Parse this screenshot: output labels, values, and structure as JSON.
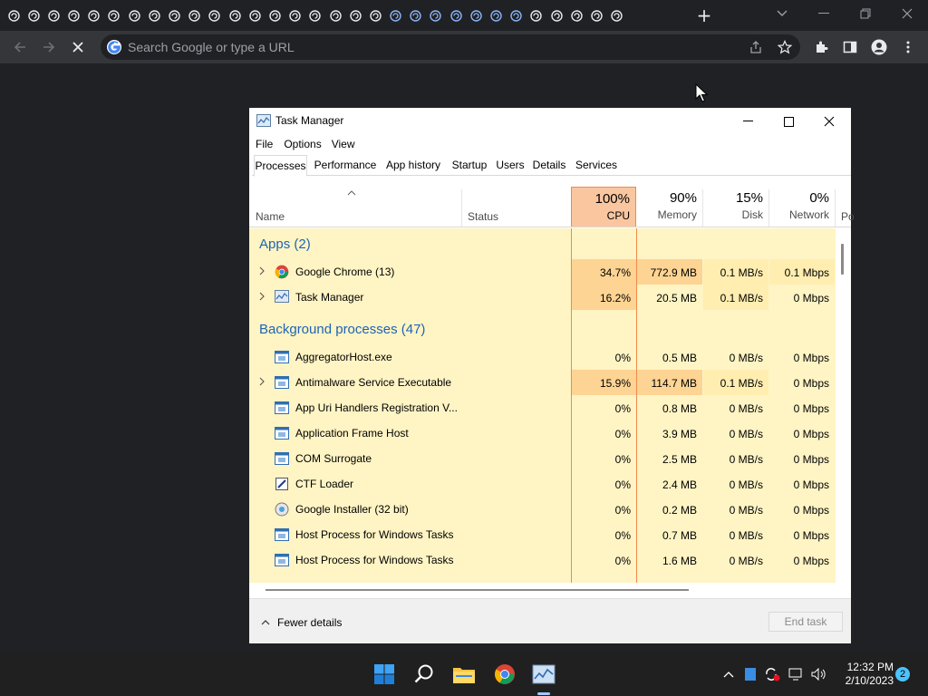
{
  "browser": {
    "tab_count": 31,
    "address_placeholder": "Search Google or type a URL",
    "new_tab_label": "+"
  },
  "taskmanager": {
    "title": "Task Manager",
    "menu": [
      "File",
      "Options",
      "View"
    ],
    "tabs": [
      "Processes",
      "Performance",
      "App history",
      "Startup",
      "Users",
      "Details",
      "Services"
    ],
    "active_tab": "Processes",
    "columns": {
      "name": "Name",
      "status": "Status",
      "cpu": {
        "percent": "100%",
        "label": "CPU"
      },
      "memory": {
        "percent": "90%",
        "label": "Memory"
      },
      "disk": {
        "percent": "15%",
        "label": "Disk"
      },
      "network": {
        "percent": "0%",
        "label": "Network"
      },
      "power_truncated": "Po"
    },
    "groups": {
      "apps": "Apps (2)",
      "background": "Background processes (47)"
    },
    "apps": [
      {
        "name": "Google Chrome (13)",
        "cpu": "34.7%",
        "memory": "772.9 MB",
        "disk": "0.1 MB/s",
        "network": "0.1 Mbps",
        "expandable": true,
        "icon": "chrome-icon"
      },
      {
        "name": "Task Manager",
        "cpu": "16.2%",
        "memory": "20.5 MB",
        "disk": "0.1 MB/s",
        "network": "0 Mbps",
        "expandable": true,
        "icon": "taskmanager-icon"
      }
    ],
    "background": [
      {
        "name": "AggregatorHost.exe",
        "cpu": "0%",
        "memory": "0.5 MB",
        "disk": "0 MB/s",
        "network": "0 Mbps",
        "expandable": false,
        "icon": "process-icon"
      },
      {
        "name": "Antimalware Service Executable",
        "cpu": "15.9%",
        "memory": "114.7 MB",
        "disk": "0.1 MB/s",
        "network": "0 Mbps",
        "expandable": true,
        "icon": "process-icon"
      },
      {
        "name": "App Uri Handlers Registration V...",
        "cpu": "0%",
        "memory": "0.8 MB",
        "disk": "0 MB/s",
        "network": "0 Mbps",
        "expandable": false,
        "icon": "process-icon"
      },
      {
        "name": "Application Frame Host",
        "cpu": "0%",
        "memory": "3.9 MB",
        "disk": "0 MB/s",
        "network": "0 Mbps",
        "expandable": false,
        "icon": "process-icon"
      },
      {
        "name": "COM Surrogate",
        "cpu": "0%",
        "memory": "2.5 MB",
        "disk": "0 MB/s",
        "network": "0 Mbps",
        "expandable": false,
        "icon": "process-icon"
      },
      {
        "name": "CTF Loader",
        "cpu": "0%",
        "memory": "2.4 MB",
        "disk": "0 MB/s",
        "network": "0 Mbps",
        "expandable": false,
        "icon": "ctf-loader-icon"
      },
      {
        "name": "Google Installer (32 bit)",
        "cpu": "0%",
        "memory": "0.2 MB",
        "disk": "0 MB/s",
        "network": "0 Mbps",
        "expandable": false,
        "icon": "installer-icon"
      },
      {
        "name": "Host Process for Windows Tasks",
        "cpu": "0%",
        "memory": "0.7 MB",
        "disk": "0 MB/s",
        "network": "0 Mbps",
        "expandable": false,
        "icon": "process-icon"
      },
      {
        "name": "Host Process for Windows Tasks",
        "cpu": "0%",
        "memory": "1.6 MB",
        "disk": "0 MB/s",
        "network": "0 Mbps",
        "expandable": false,
        "icon": "process-icon"
      }
    ],
    "footer": {
      "fewer_details": "Fewer details",
      "end_task": "End task"
    }
  },
  "taskbar": {
    "time": "12:32 PM",
    "date": "2/10/2023",
    "notification_count": "2"
  },
  "colors": {
    "chrome_bg": "#202124",
    "toolbar_bg": "#35363a",
    "cpu_header": "#f9c6a0",
    "cpu_border": "#f08a4b",
    "heat_high": "#fdd493",
    "heat_low": "#fff4c4",
    "group_text": "#1e64b4",
    "taskbar_bg": "#202020"
  }
}
